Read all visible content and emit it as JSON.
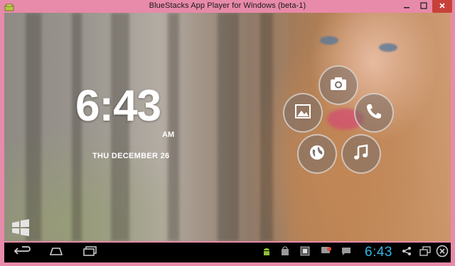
{
  "window": {
    "title": "BlueStacks App Player for Windows (beta-1)",
    "app_icon": "bluestacks-icon",
    "controls": [
      "minimize-icon",
      "maximize-icon",
      "close-icon"
    ],
    "accent_color": "#e88aa9",
    "close_color": "#c8403a"
  },
  "lockscreen": {
    "time": "6:43",
    "ampm": "AM",
    "date": "THU DECEMBER 26",
    "shortcuts": [
      "camera-icon",
      "phone-icon",
      "music-icon",
      "browser-icon",
      "gallery-icon"
    ],
    "apps_icon": "app-grid-icon"
  },
  "navbar": {
    "buttons": [
      "back-icon",
      "home-icon",
      "recent-apps-icon"
    ],
    "status_icons": [
      "android-icon",
      "store-icon",
      "app-icon",
      "notification-icon",
      "chat-icon"
    ],
    "time": "6:43",
    "time_color": "#33b5e5",
    "right_icons": [
      "share-icon",
      "window-icon",
      "close-circle-icon"
    ]
  }
}
